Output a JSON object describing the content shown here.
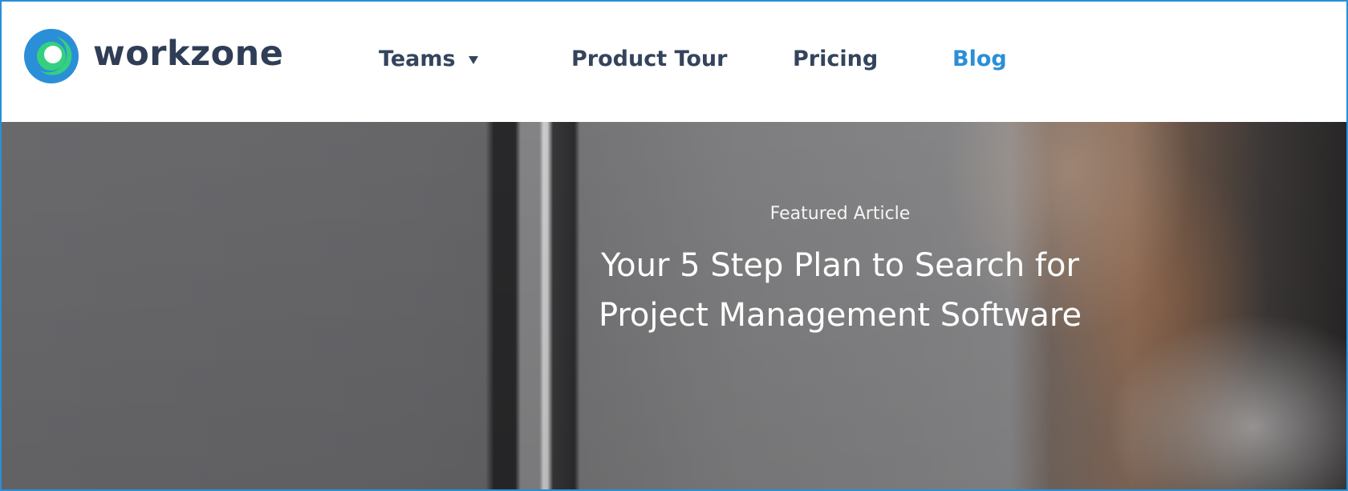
{
  "brand": {
    "name": "workzone",
    "colors": {
      "logo_blue": "#2a8fd6",
      "logo_green": "#35d07f",
      "text_dark": "#2f3e56",
      "link_active": "#2a8fd6"
    }
  },
  "nav": {
    "items": [
      {
        "label": "Teams",
        "has_dropdown": true
      },
      {
        "label": "Product Tour"
      },
      {
        "label": "Pricing"
      },
      {
        "label": "Blog",
        "active": true
      }
    ],
    "dropdown_icon": "caret-down-icon"
  },
  "hero": {
    "eyebrow": "Featured Article",
    "title_line1": "Your 5 Step Plan to Search for",
    "title_line2": "Project Management Software"
  }
}
